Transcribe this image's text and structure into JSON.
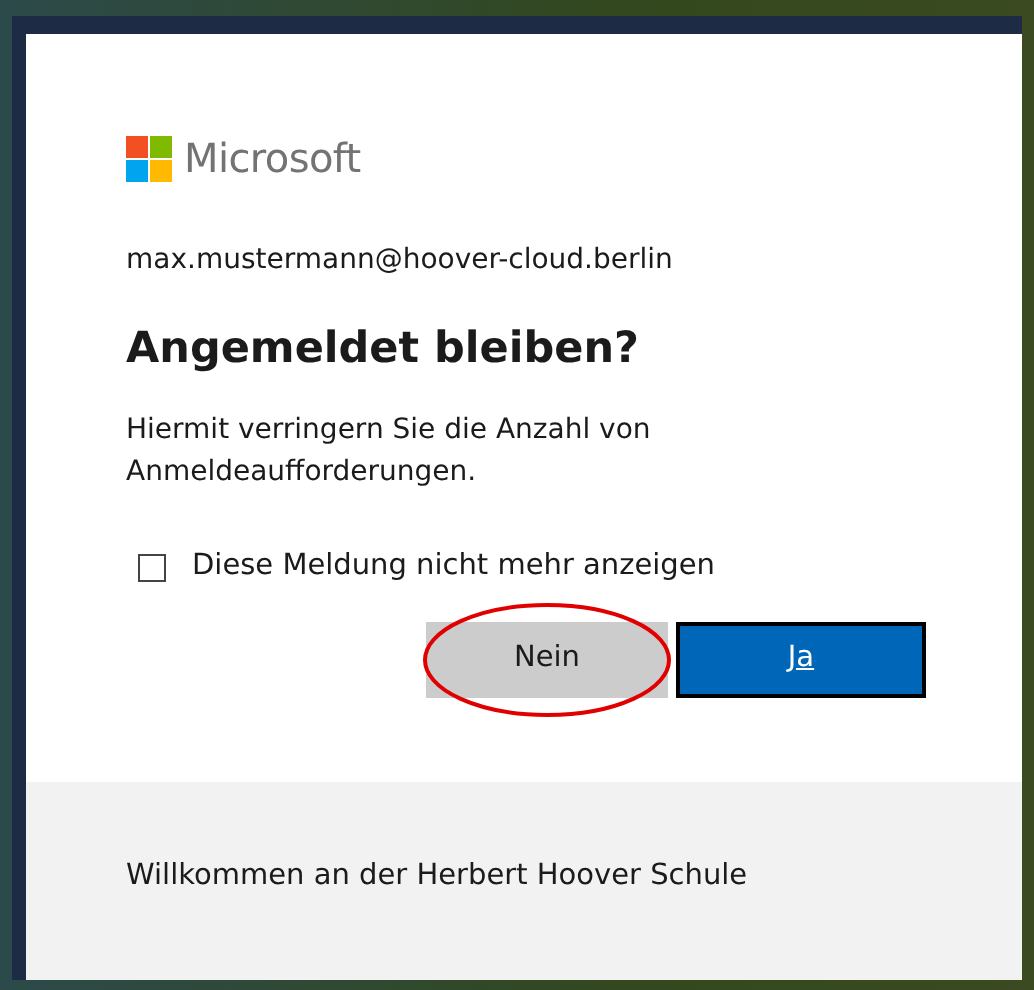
{
  "logo": {
    "text": "Microsoft"
  },
  "account": "max.mustermann@hoover-cloud.berlin",
  "title": "Angemeldet bleiben?",
  "description": "Hiermit verringern Sie die Anzahl von Anmeldeaufforderungen.",
  "checkbox": {
    "label": "Diese Meldung nicht mehr anzeigen",
    "checked": false
  },
  "buttons": [
    {
      "label": "Nein",
      "kind": "secondary",
      "circled": true
    },
    {
      "label": "Ja",
      "kind": "primary",
      "circled": false
    }
  ],
  "footer": "Willkommen an der Herbert Hoover Schule"
}
